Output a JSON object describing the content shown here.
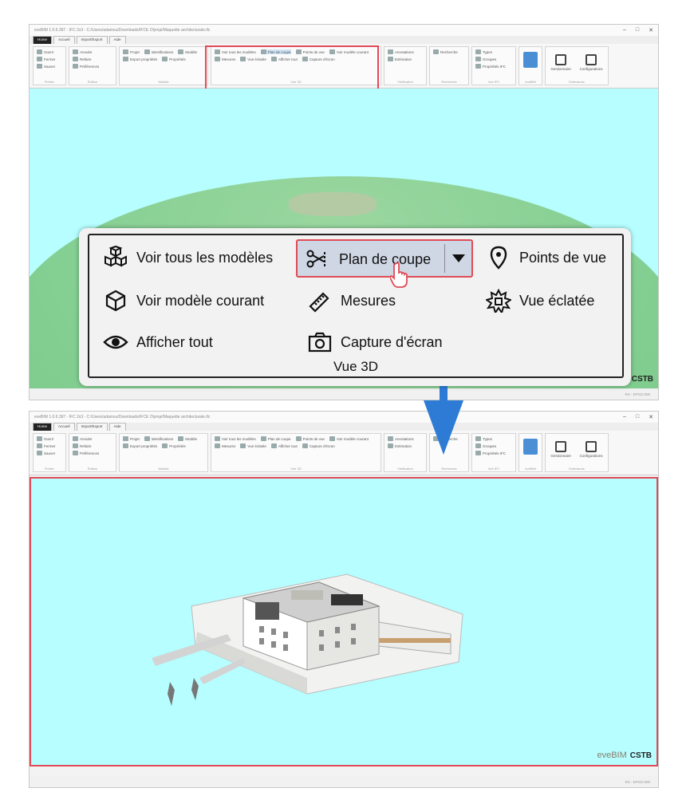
{
  "app": {
    "title": "eveBIM 1.0.6.397 - IFC 2x3 - C:/Users/adamou/Downloads/IFCE Olympi/Maquette architecturale.ifc",
    "status_text": "RS - EPSG:000",
    "logo_eve": "eveBIM",
    "logo_org": "CSTB"
  },
  "ribbon_tabs": [
    "Home",
    "Accueil",
    "Import/Export",
    "Aide"
  ],
  "ribbon_groups": [
    {
      "label": "Fichier",
      "items": [
        "Ouvrir",
        "Fermer",
        "Sauver"
      ]
    },
    {
      "label": "Édition",
      "items": [
        "Annuler",
        "Refaire",
        "Préférences"
      ]
    },
    {
      "label": "Modèle",
      "items": [
        "Projet",
        "Modèle",
        "Propriétés",
        "Identifications",
        "Export propriétés"
      ]
    },
    {
      "label": "Vue 3D",
      "items": [
        "Voir tous les modèles",
        "Plan de coupe",
        "Points de vue",
        "Voir modèle courant",
        "Mesures",
        "Vue éclatée",
        "Afficher tout",
        "Capture d'écran"
      ]
    },
    {
      "label": "Vérification",
      "items": [
        "Annotations",
        "Estimation"
      ]
    },
    {
      "label": "Recherche",
      "items": [
        "Recherche"
      ]
    },
    {
      "label": "Vue IFC",
      "items": [
        "Types",
        "Groupes",
        "Propriétés IFC"
      ]
    },
    {
      "label": "eveBIM",
      "items": []
    },
    {
      "label": "Extensions",
      "items": [
        "Gestionnaire",
        "Configurations"
      ]
    }
  ],
  "popup": {
    "group_title": "Vue 3D",
    "buttons": {
      "voir_tous": "Voir tous les modèles",
      "plan_coupe": "Plan de coupe",
      "points_vue": "Points de vue",
      "voir_courant": "Voir modèle courant",
      "mesures": "Mesures",
      "vue_eclatee": "Vue éclatée",
      "afficher_tout": "Afficher tout",
      "capture": "Capture d'écran"
    }
  },
  "colors": {
    "viewport_bg": "#b6feff",
    "highlight_red": "#e04b57",
    "arrow_blue": "#2e7bd6",
    "selected_button": "#cfd6e4"
  }
}
